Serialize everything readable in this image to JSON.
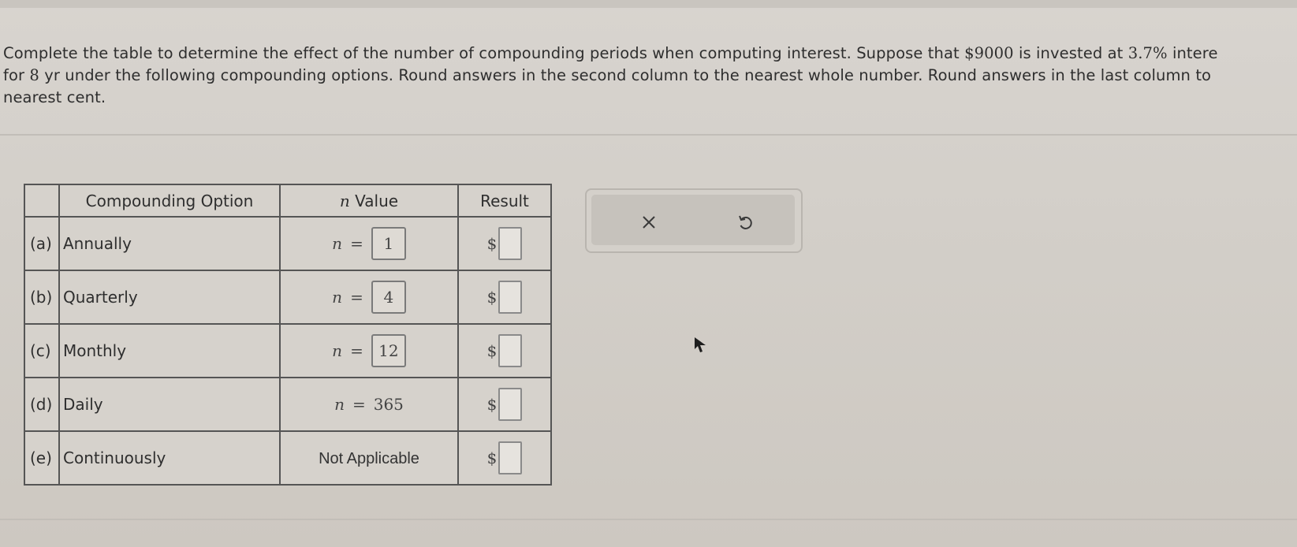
{
  "question": {
    "line1_a": "Complete the table to determine the effect of the number of compounding periods when computing interest. Suppose that ",
    "principal": "$9000",
    "line1_b": " is invested at ",
    "rate": "3.7%",
    "line1_c": " intere",
    "line2_a": "for ",
    "years": "8",
    "line2_b": " yr under the following compounding options. Round answers in the second column to the nearest whole number. Round answers in the last column to",
    "line3": "nearest cent."
  },
  "table": {
    "headers": {
      "option": "Compounding Option",
      "n_var": "n",
      "n_label": " Value",
      "result": "Result"
    },
    "rows": [
      {
        "letter": "(a)",
        "option": "Annually",
        "n_var": "n",
        "n_eq": "=",
        "n_value": "1",
        "n_mode": "box",
        "currency": "$",
        "result": ""
      },
      {
        "letter": "(b)",
        "option": "Quarterly",
        "n_var": "n",
        "n_eq": "=",
        "n_value": "4",
        "n_mode": "box",
        "currency": "$",
        "result": ""
      },
      {
        "letter": "(c)",
        "option": "Monthly",
        "n_var": "n",
        "n_eq": "=",
        "n_value": "12",
        "n_mode": "box",
        "currency": "$",
        "result": ""
      },
      {
        "letter": "(d)",
        "option": "Daily",
        "n_var": "n",
        "n_eq": "=",
        "n_value": "365",
        "n_mode": "plain",
        "currency": "$",
        "result": ""
      },
      {
        "letter": "(e)",
        "option": "Continuously",
        "n_text": "Not Applicable",
        "n_mode": "text",
        "currency": "$",
        "result": ""
      }
    ]
  },
  "actions": {
    "clear_icon": "close-icon",
    "undo_icon": "undo-icon"
  },
  "colors": {
    "background": "#d3cfc9",
    "table_border": "#555555",
    "icon": "#3a3a3a"
  }
}
